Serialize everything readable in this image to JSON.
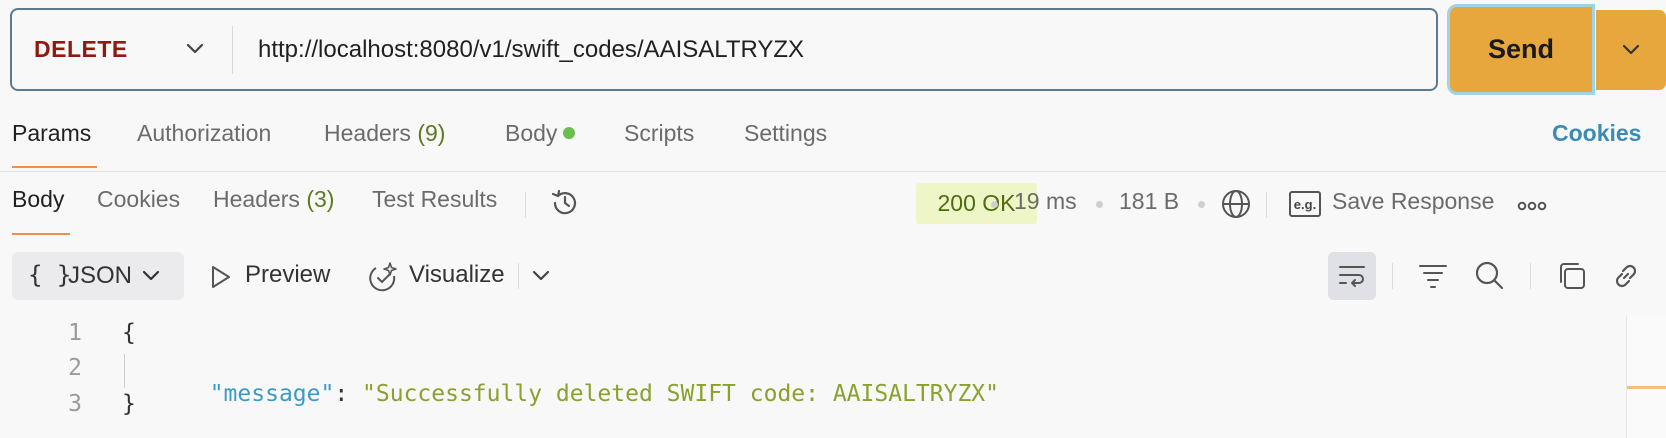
{
  "request": {
    "method": "DELETE",
    "url": "http://localhost:8080/v1/swift_codes/AAISALTRYZX",
    "send_label": "Send"
  },
  "request_tabs": [
    {
      "label": "Params",
      "active": true
    },
    {
      "label": "Authorization"
    },
    {
      "label": "Headers",
      "count": "(9)"
    },
    {
      "label": "Body"
    },
    {
      "label": "Scripts"
    },
    {
      "label": "Settings"
    }
  ],
  "cookies_link": "Cookies",
  "response_tabs": [
    {
      "label": "Body",
      "active": true
    },
    {
      "label": "Cookies"
    },
    {
      "label": "Headers",
      "count": "(3)"
    },
    {
      "label": "Test Results"
    }
  ],
  "response_meta": {
    "status": "200 OK",
    "time": "19 ms",
    "size": "181 B",
    "save_label": "Save Response",
    "eg_label": "e.g."
  },
  "response_toolbar": {
    "format": "JSON",
    "format_icon": "{ }",
    "preview_label": "Preview",
    "visualize_label": "Visualize"
  },
  "code": {
    "line_numbers": [
      "1",
      "2",
      "3"
    ],
    "open_brace": "{",
    "key": "\"message\"",
    "colon": ": ",
    "value": "\"Successfully deleted SWIFT code: AAISALTRYZX\"",
    "close_brace": "}"
  },
  "colors": {
    "send": "#e8a73c",
    "method": "#8e1a10",
    "status_bg": "#eef6c8",
    "active_underline": "#f28d4b",
    "json_key": "#3d9ac5",
    "json_string": "#8aa12e"
  }
}
